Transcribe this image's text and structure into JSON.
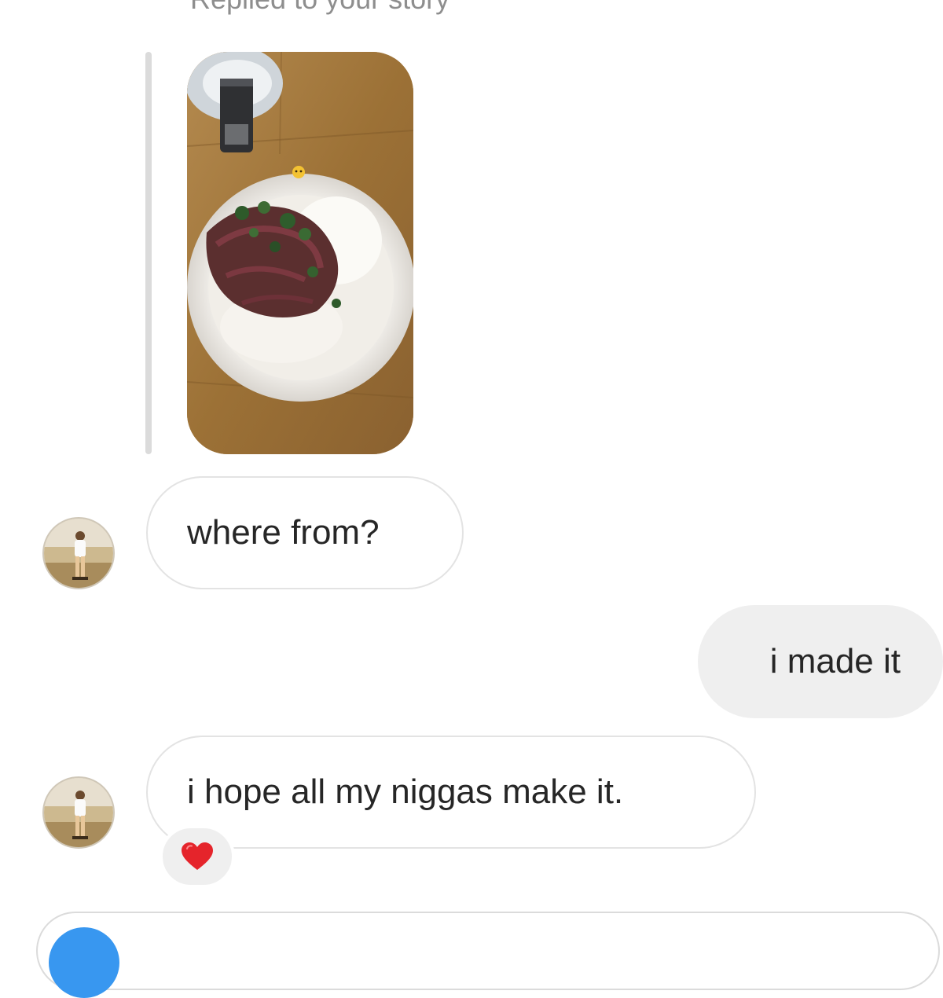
{
  "thread": {
    "replied_label": "Replied to your story",
    "messages": [
      {
        "text": "where from?"
      },
      {
        "text": "i made it"
      },
      {
        "text": "i hope all my niggas make it."
      }
    ],
    "reaction": {
      "icon": "heart-icon",
      "color": "#e5242b"
    }
  },
  "colors": {
    "incoming_border": "#e3e3e3",
    "outgoing_bg": "#efefef",
    "accent": "#3897f0"
  }
}
